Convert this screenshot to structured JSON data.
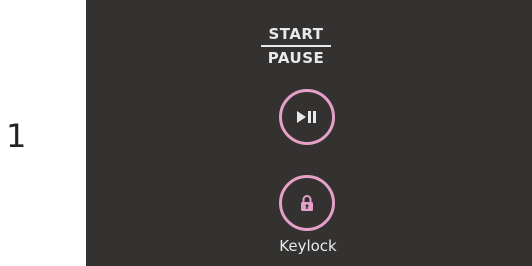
{
  "step": {
    "number": "1"
  },
  "controls": {
    "start_label": "START",
    "pause_label": "PAUSE",
    "play_pause_icon": "play-pause-icon",
    "lock_icon": "lock-icon",
    "keylock_label": "Keylock"
  },
  "colors": {
    "panel_background": "#333231",
    "accent": "#e4a0c7",
    "label_text": "#e9e9e9"
  }
}
